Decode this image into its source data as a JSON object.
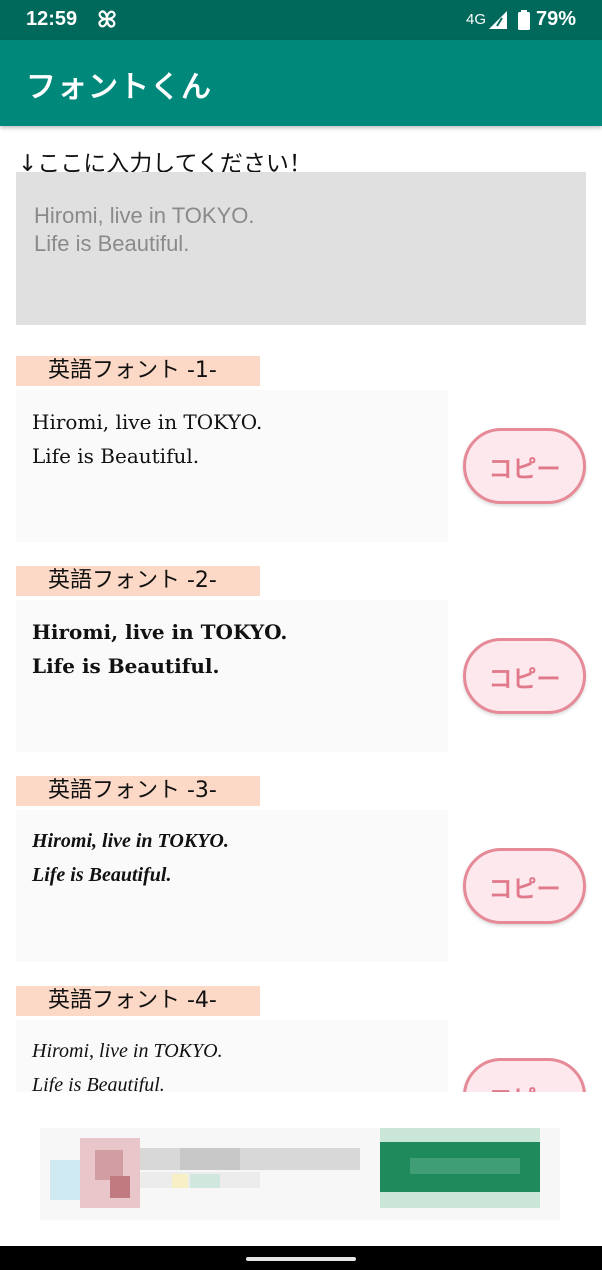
{
  "status_bar": {
    "time": "12:59",
    "network": "4G",
    "battery": "79%"
  },
  "app_bar": {
    "title": "フォントくん"
  },
  "prompt": "↓ここに入力してください！",
  "input": {
    "value": "Hiromi, live in TOKYO.\nLife is Beautiful."
  },
  "sections": [
    {
      "label": "英語フォント -1-",
      "line1": "Hiromi, live in TOKYO.",
      "line2": "Life is Beautiful.",
      "button": "コピー"
    },
    {
      "label": "英語フォント -2-",
      "line1": "Hiromi, live in TOKYO.",
      "line2": "Life is Beautiful.",
      "button": "コピー"
    },
    {
      "label": "英語フォント -3-",
      "line1": "Hiromi, live in TOKYO.",
      "line2": "Life is Beautiful.",
      "button": "コピー"
    },
    {
      "label": "英語フォント -4-",
      "line1": "Hiromi, live in TOKYO.",
      "line2": "Life is Beautiful.",
      "button": "コピー"
    }
  ],
  "colors": {
    "status_bar": "#00695c",
    "app_bar": "#00897b",
    "label_bg": "#fbd9c6",
    "input_bg": "#e0e0e0",
    "button_border": "#e58a96",
    "button_text": "#e07a8a"
  }
}
